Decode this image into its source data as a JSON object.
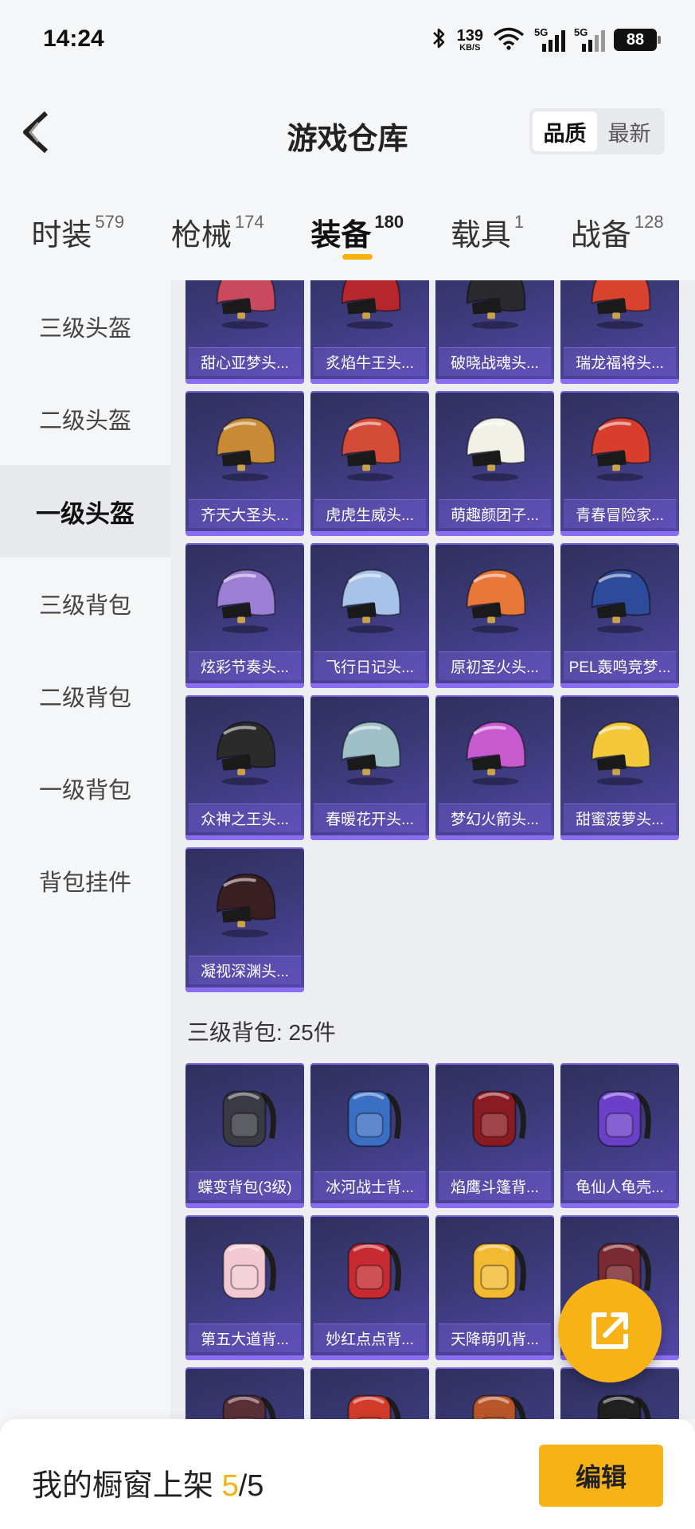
{
  "status": {
    "time": "14:24",
    "speed_value": "139",
    "speed_unit": "KB/S",
    "battery": "88",
    "network": "5G"
  },
  "header": {
    "title": "游戏仓库",
    "sort_options": [
      "品质",
      "最新"
    ],
    "active_sort": "品质"
  },
  "tabs": [
    {
      "label": "时装",
      "count": "579"
    },
    {
      "label": "枪械",
      "count": "174"
    },
    {
      "label": "装备",
      "count": "180",
      "active": true
    },
    {
      "label": "载具",
      "count": "1"
    },
    {
      "label": "战备",
      "count": "128"
    }
  ],
  "sidebar": {
    "items": [
      "三级头盔",
      "二级头盔",
      "一级头盔",
      "三级背包",
      "二级背包",
      "一级背包",
      "背包挂件"
    ],
    "active": "一级头盔"
  },
  "helmets": [
    {
      "name": "甜心亚梦头...",
      "color": "#c94a5e"
    },
    {
      "name": "炙焰牛王头...",
      "color": "#b5262d"
    },
    {
      "name": "破晓战魂头...",
      "color": "#2a2a2e"
    },
    {
      "name": "瑞龙福将头...",
      "color": "#d8432f"
    },
    {
      "name": "齐天大圣头...",
      "color": "#c88a35"
    },
    {
      "name": "虎虎生威头...",
      "color": "#d44b38"
    },
    {
      "name": "萌趣颜团子...",
      "color": "#f1f1e8"
    },
    {
      "name": "青春冒险家...",
      "color": "#d83e2e"
    },
    {
      "name": "炫彩节奏头...",
      "color": "#9b7fd4"
    },
    {
      "name": "飞行日记头...",
      "color": "#a8c3ea"
    },
    {
      "name": "原初圣火头...",
      "color": "#e8773a"
    },
    {
      "name": "PEL轰鸣竞梦...",
      "color": "#2d4b9a"
    },
    {
      "name": "众神之王头...",
      "color": "#2b2b2b"
    },
    {
      "name": "春暖花开头...",
      "color": "#9fc0c8"
    },
    {
      "name": "梦幻火箭头...",
      "color": "#c85ad0"
    },
    {
      "name": "甜蜜菠萝头...",
      "color": "#f3c83a"
    },
    {
      "name": "凝视深渊头...",
      "color": "#3a1f22"
    }
  ],
  "backpack_section": {
    "title": "三级背包: 25件"
  },
  "backpacks": [
    {
      "name": "蝶变背包(3级)",
      "color": "#3a3a44"
    },
    {
      "name": "冰河战士背...",
      "color": "#3b6fc4"
    },
    {
      "name": "焰鹰斗篷背...",
      "color": "#8a1b22"
    },
    {
      "name": "龟仙人龟壳...",
      "color": "#6b3fc8"
    },
    {
      "name": "第五大道背...",
      "color": "#f2c9d2"
    },
    {
      "name": "妙红点点背...",
      "color": "#c52b30"
    },
    {
      "name": "天降萌叽背...",
      "color": "#f2b932"
    },
    {
      "name": "",
      "color": "#7a2a30"
    },
    {
      "name": "",
      "color": "#5a3038"
    },
    {
      "name": "",
      "color": "#d23a2a"
    },
    {
      "name": "",
      "color": "#b8562a"
    },
    {
      "name": "",
      "color": "#202020"
    }
  ],
  "bottom": {
    "label": "我的橱窗上架",
    "current": "5",
    "separator": "/",
    "total": "5",
    "edit_label": "编辑"
  },
  "accent_color": "#f5b10c"
}
